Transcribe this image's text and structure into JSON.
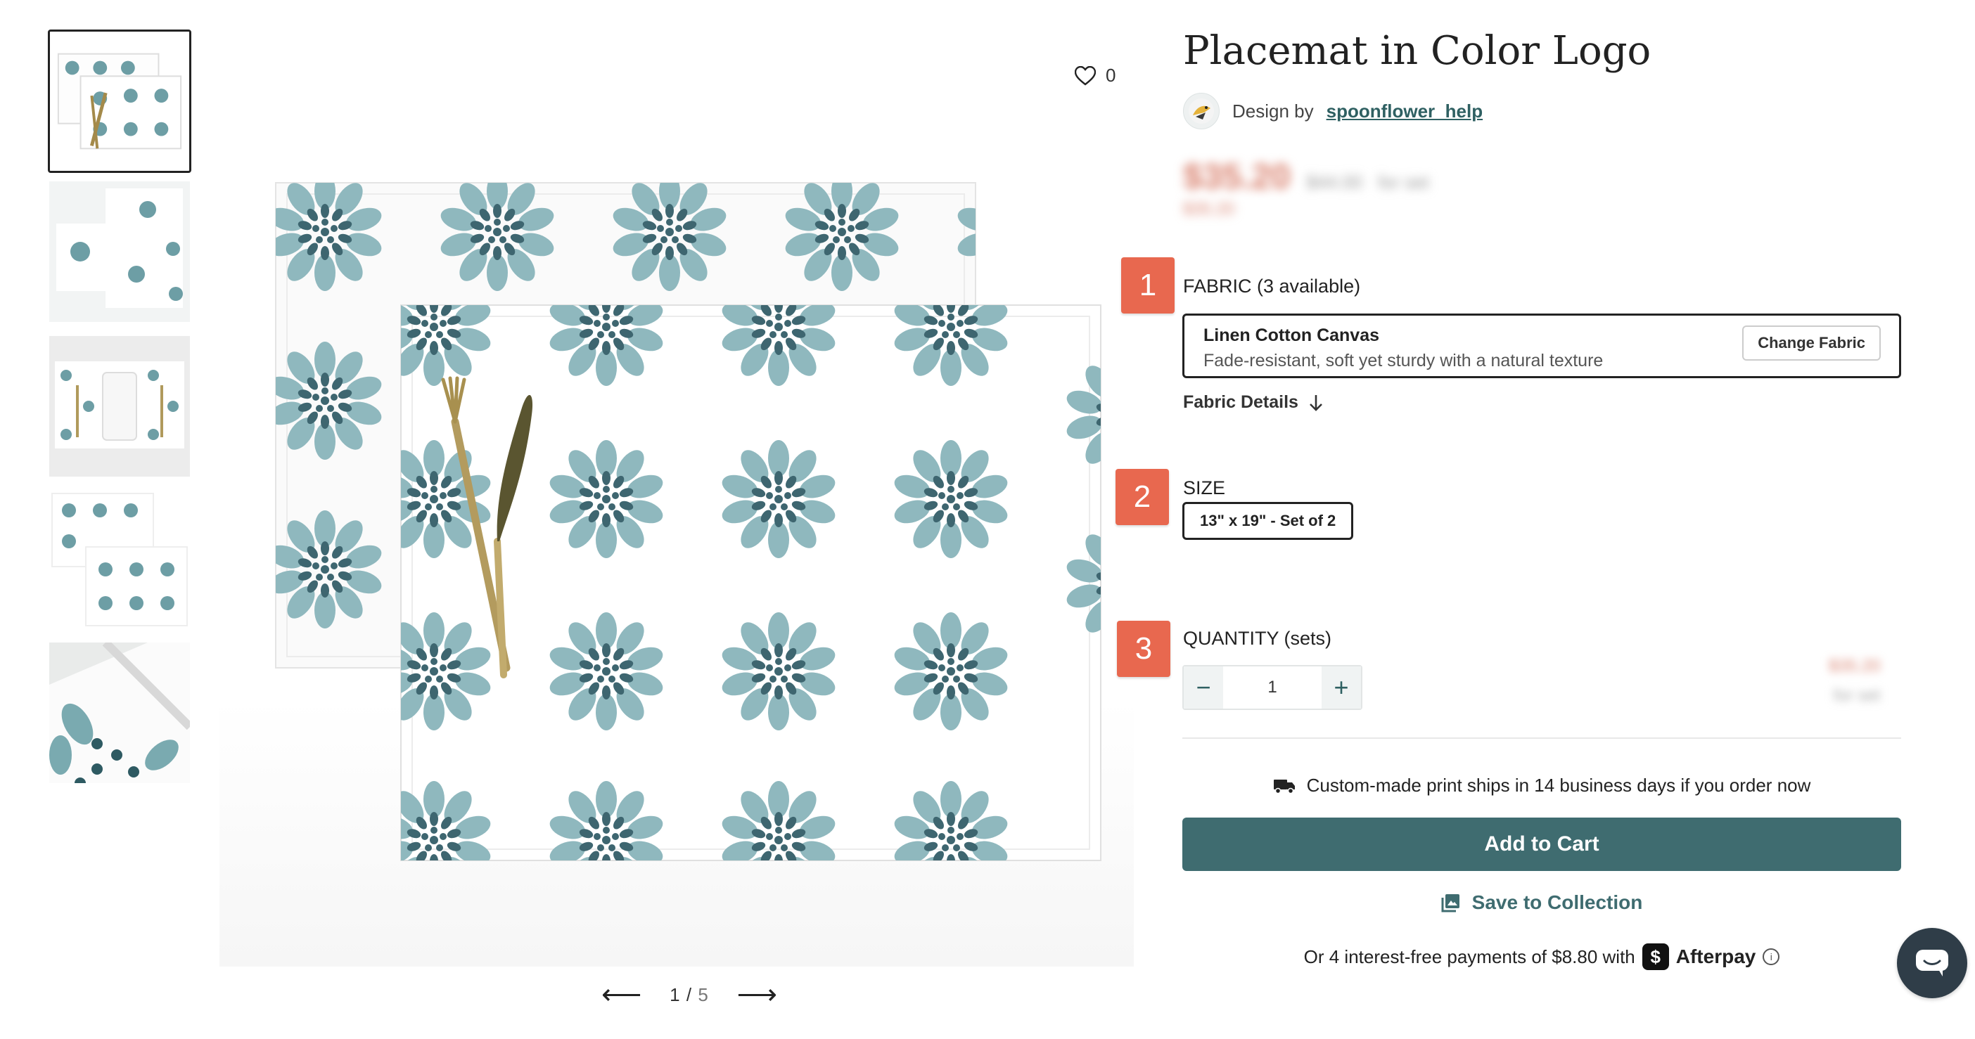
{
  "product": {
    "title": "Placemat in Color Logo",
    "design_by_prefix": "Design by",
    "designer": "spoonflower_help",
    "price_main": "$35.20",
    "price_old": "$44.00",
    "price_unit": "for set",
    "price_sale": "$35.20"
  },
  "gallery": {
    "favorite_count": "0",
    "page_current": "1",
    "page_sep": "/",
    "page_total": "5",
    "thumbnail_count": 5
  },
  "fabric": {
    "label": "FABRIC (3 available)",
    "selected_name": "Linen Cotton Canvas",
    "selected_desc": "Fade-resistant, soft yet sturdy with a natural texture",
    "change_label": "Change Fabric",
    "details_label": "Fabric Details"
  },
  "size": {
    "label": "SIZE",
    "selected": "13\" x 19\" - Set of 2"
  },
  "quantity": {
    "label": "QUANTITY (sets)",
    "value": "1",
    "minus": "−",
    "plus": "+",
    "line_price": "$35.20",
    "line_unit": "for set"
  },
  "shipping": {
    "text": "Custom-made print ships in 14 business days if you order now"
  },
  "actions": {
    "add_to_cart": "Add to Cart",
    "save_to_collection": "Save to Collection"
  },
  "afterpay": {
    "text": "Or 4 interest-free payments of $8.80 with",
    "logo_symbol": "$",
    "brand": "Afterpay",
    "info": "i"
  },
  "steps": [
    "1",
    "2",
    "3"
  ],
  "colors": {
    "accent": "#3f6c70",
    "step_badge": "#e8684f",
    "pattern_light": "#8fb8be",
    "pattern_dark": "#3e6670"
  }
}
